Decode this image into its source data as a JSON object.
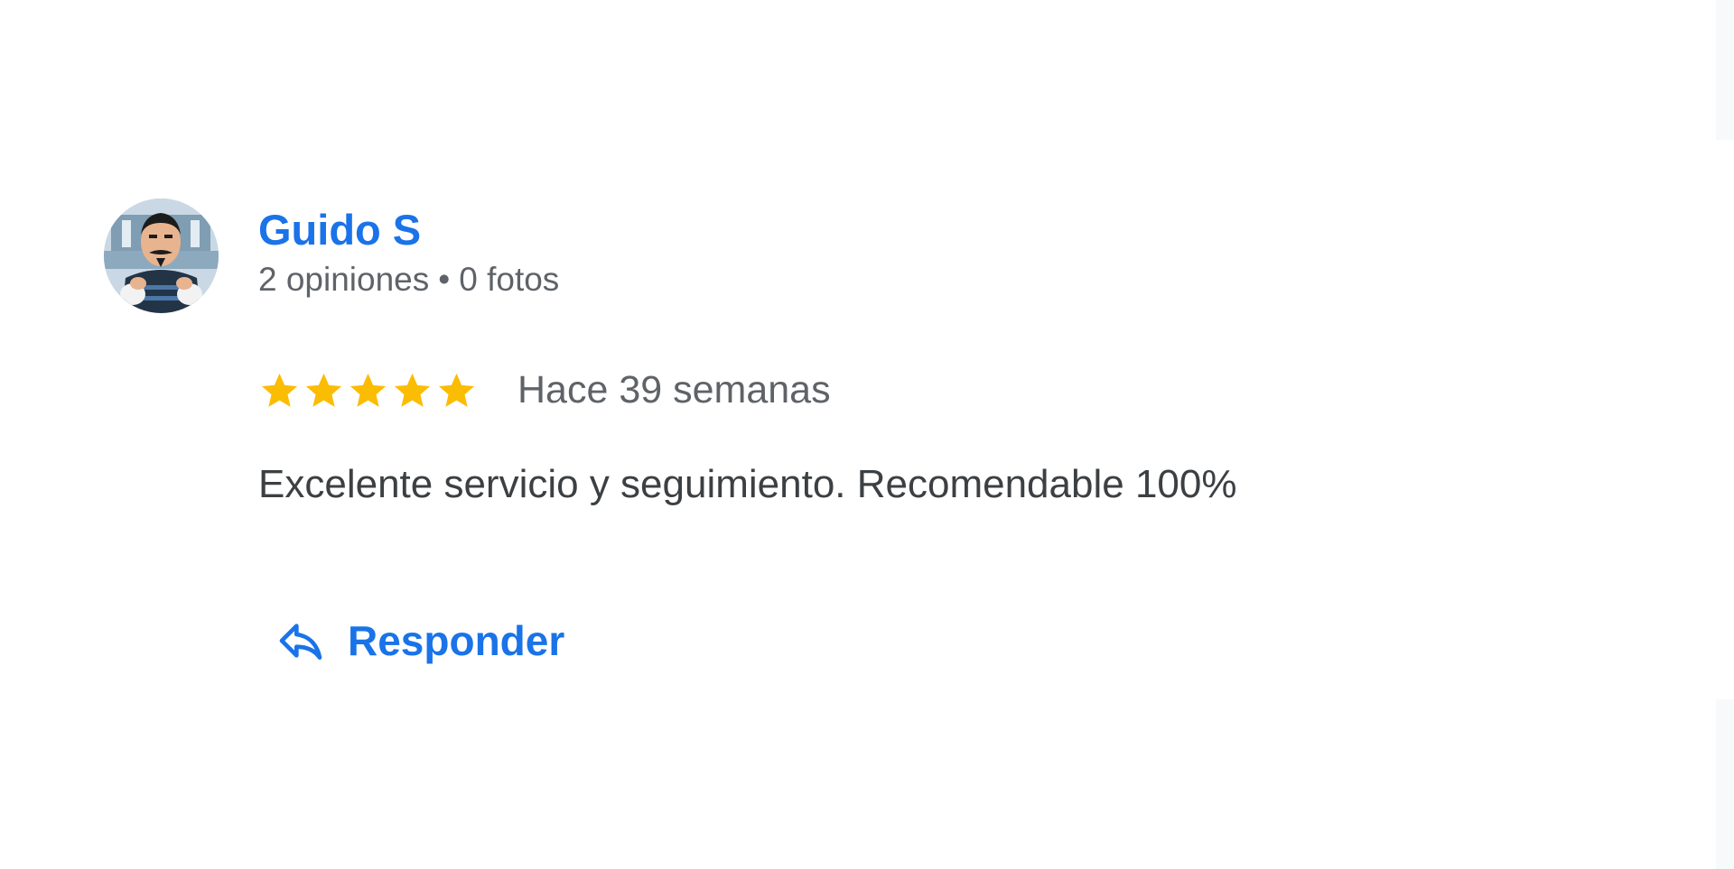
{
  "review": {
    "author": {
      "name": "Guido S",
      "reviews_count": "2 opiniones",
      "separator": "•",
      "photos_count": "0 fotos",
      "avatar_icon": "avatar-illustration"
    },
    "rating": {
      "stars": 5,
      "max_stars": 5,
      "star_color": "#fbbc04",
      "star_icon": "star-icon"
    },
    "date": "Hace 39 semanas",
    "text": "Excelente servicio y seguimiento. Recomendable 100%",
    "reply": {
      "label": "Responder",
      "icon": "reply-icon"
    }
  },
  "colors": {
    "link": "#1a73e8",
    "secondary_text": "#5f6368",
    "body_text": "#3c4043",
    "background": "#ffffff"
  }
}
